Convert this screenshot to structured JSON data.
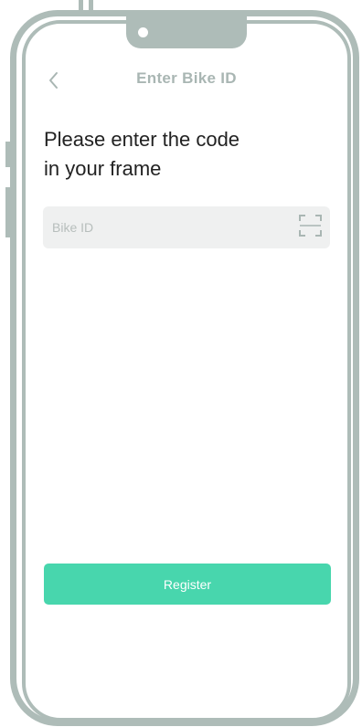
{
  "header": {
    "title": "Enter Bike ID",
    "back_icon": "chevron-left-icon"
  },
  "main": {
    "heading_line1": "Please enter the code",
    "heading_line2": "in your frame",
    "bike_id_input": {
      "placeholder": "Bike ID",
      "value": "",
      "scan_icon": "scan-frame-icon"
    },
    "register_label": "Register"
  },
  "colors": {
    "accent": "#48d6ad",
    "title": "#a9b6b3",
    "frame": "#aebcb8",
    "input_bg": "#eff0f0"
  }
}
